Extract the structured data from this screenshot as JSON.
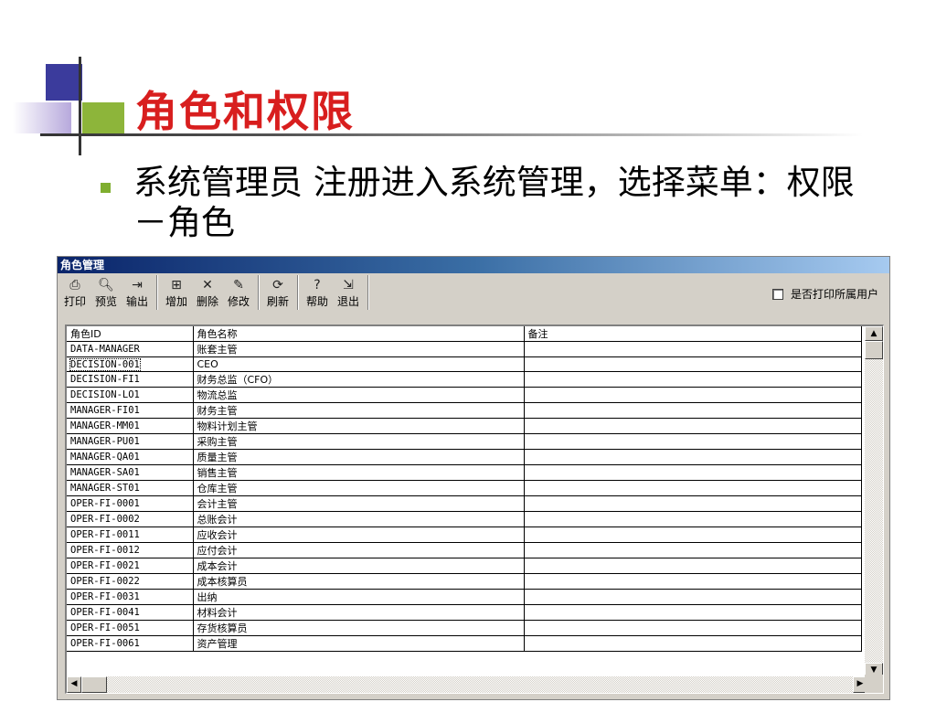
{
  "slide": {
    "title": "角色和权限",
    "bullet": "系统管理员 注册进入系统管理，选择菜单：权限－角色"
  },
  "window": {
    "title": "角色管理"
  },
  "toolbar": {
    "groups": [
      [
        {
          "label": "打印",
          "icon": "printer-icon",
          "glyph": "⎙"
        },
        {
          "label": "预览",
          "icon": "preview-icon",
          "glyph": "🔍︎"
        },
        {
          "label": "输出",
          "icon": "export-icon",
          "glyph": "⇥"
        }
      ],
      [
        {
          "label": "增加",
          "icon": "add-icon",
          "glyph": "⊞"
        },
        {
          "label": "删除",
          "icon": "delete-icon",
          "glyph": "✕"
        },
        {
          "label": "修改",
          "icon": "edit-icon",
          "glyph": "✎"
        }
      ],
      [
        {
          "label": "刷新",
          "icon": "refresh-icon",
          "glyph": "⟳"
        }
      ],
      [
        {
          "label": "帮助",
          "icon": "help-icon",
          "glyph": "?"
        },
        {
          "label": "退出",
          "icon": "exit-icon",
          "glyph": "⇲"
        }
      ]
    ],
    "checkbox_label": "是否打印所属用户",
    "checkbox_checked": false
  },
  "grid": {
    "columns": [
      "角色ID",
      "角色名称",
      "备注"
    ],
    "selected_index": 1,
    "rows": [
      [
        "DATA-MANAGER",
        "账套主管",
        ""
      ],
      [
        "DECISION-001",
        "CEO",
        ""
      ],
      [
        "DECISION-FI1",
        "财务总监（CFO）",
        ""
      ],
      [
        "DECISION-LO1",
        "物流总监",
        ""
      ],
      [
        "MANAGER-FI01",
        "财务主管",
        ""
      ],
      [
        "MANAGER-MM01",
        "物料计划主管",
        ""
      ],
      [
        "MANAGER-PU01",
        "采购主管",
        ""
      ],
      [
        "MANAGER-QA01",
        "质量主管",
        ""
      ],
      [
        "MANAGER-SA01",
        "销售主管",
        ""
      ],
      [
        "MANAGER-ST01",
        "仓库主管",
        ""
      ],
      [
        "OPER-FI-0001",
        "会计主管",
        ""
      ],
      [
        "OPER-FI-0002",
        "总账会计",
        ""
      ],
      [
        "OPER-FI-0011",
        "应收会计",
        ""
      ],
      [
        "OPER-FI-0012",
        "应付会计",
        ""
      ],
      [
        "OPER-FI-0021",
        "成本会计",
        ""
      ],
      [
        "OPER-FI-0022",
        "成本核算员",
        ""
      ],
      [
        "OPER-FI-0031",
        "出纳",
        ""
      ],
      [
        "OPER-FI-0041",
        "材料会计",
        ""
      ],
      [
        "OPER-FI-0051",
        "存货核算员",
        ""
      ],
      [
        "OPER-FI-0061",
        "资产管理",
        ""
      ]
    ]
  }
}
